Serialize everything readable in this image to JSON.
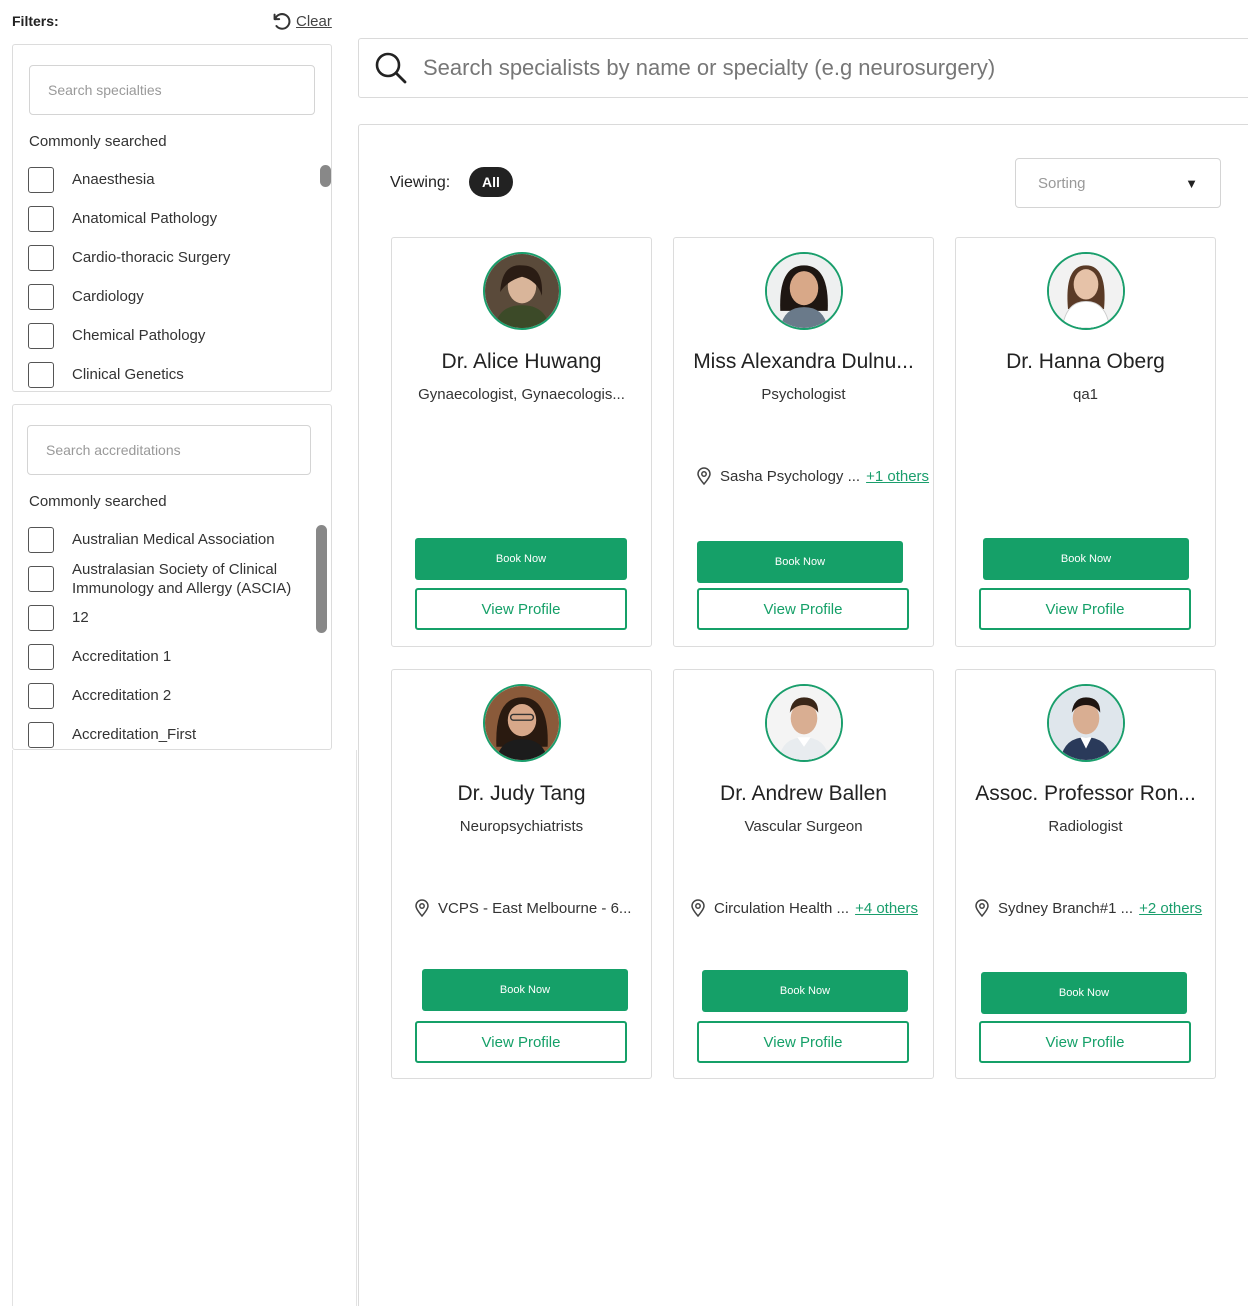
{
  "filters": {
    "title": "Filters:",
    "clear_label": "Clear"
  },
  "specialties": {
    "placeholder": "Search specialties",
    "heading": "Commonly searched",
    "items": [
      "Anaesthesia",
      "Anatomical Pathology",
      "Cardio-thoracic Surgery",
      "Cardiology",
      "Chemical Pathology",
      "Clinical Genetics"
    ]
  },
  "accreditations": {
    "placeholder": "Search accreditations",
    "heading": "Commonly searched",
    "items": [
      "Australian Medical Association",
      "Australasian Society of Clinical Immunology and Allergy (ASCIA)",
      "12",
      "Accreditation 1",
      "Accreditation 2",
      "Accreditation_First"
    ]
  },
  "search": {
    "placeholder": "Search specialists by name or specialty (e.g neurosurgery)"
  },
  "viewing": {
    "label": "Viewing:",
    "pill": "All"
  },
  "sorting": {
    "label": "Sorting"
  },
  "colors": {
    "accent": "#15a068",
    "pill": "#222222"
  },
  "cards": [
    {
      "name": "Dr. Alice Huwang",
      "specialty": "Gynaecologist, Gynaecologis...",
      "location": "",
      "others": "",
      "book": "Book Now",
      "profile": "View Profile"
    },
    {
      "name": "Miss Alexandra Dulnu...",
      "specialty": "Psychologist",
      "location": "Sasha Psychology ...",
      "others": "+1 others",
      "book": "Book Now",
      "profile": "View Profile"
    },
    {
      "name": "Dr. Hanna Oberg",
      "specialty": "qa1",
      "location": "",
      "others": "",
      "book": "Book Now",
      "profile": "View Profile"
    },
    {
      "name": "Dr. Judy Tang",
      "specialty": "Neuropsychiatrists",
      "location": "VCPS - East Melbourne - 6...",
      "others": "",
      "book": "Book Now",
      "profile": "View Profile"
    },
    {
      "name": "Dr. Andrew Ballen",
      "specialty": "Vascular Surgeon",
      "location": "Circulation Health ...",
      "others": "+4 others",
      "book": "Book Now",
      "profile": "View Profile"
    },
    {
      "name": "Assoc. Professor Ron...",
      "specialty": "Radiologist",
      "location": "Sydney Branch#1 ...",
      "others": "+2 others",
      "book": "Book Now",
      "profile": "View Profile"
    }
  ]
}
